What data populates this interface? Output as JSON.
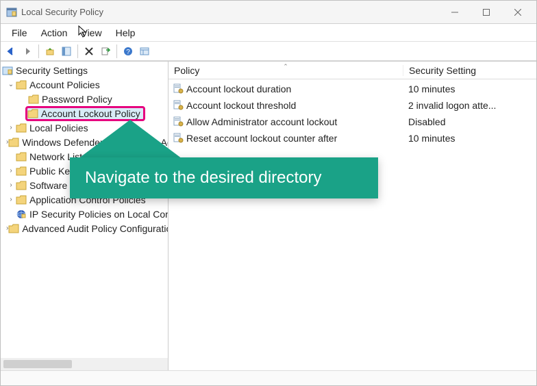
{
  "window": {
    "title": "Local Security Policy"
  },
  "menu": {
    "file": "File",
    "action": "Action",
    "view": "View",
    "help": "Help"
  },
  "columns": {
    "policy": "Policy",
    "setting": "Security Setting"
  },
  "tree": {
    "root": "Security Settings",
    "account_policies": "Account Policies",
    "password_policy": "Password Policy",
    "account_lockout_policy": "Account Lockout Policy",
    "local_policies": "Local Policies",
    "windows_defender_firewall": "Windows Defender Firewall with Adva",
    "network_list": "Network List Manager Policies",
    "public_key": "Public Key Policies",
    "software_restriction": "Software Restriction Policies",
    "application_control": "Application Control Policies",
    "ip_security": "IP Security Policies on Local Computer",
    "advanced_audit": "Advanced Audit Policy Configuration"
  },
  "policies": [
    {
      "name": "Account lockout duration",
      "value": "10 minutes"
    },
    {
      "name": "Account lockout threshold",
      "value": "2 invalid logon atte..."
    },
    {
      "name": "Allow Administrator account lockout",
      "value": "Disabled"
    },
    {
      "name": "Reset account lockout counter after",
      "value": "10 minutes"
    }
  ],
  "callout": {
    "text": "Navigate to the desired directory"
  }
}
